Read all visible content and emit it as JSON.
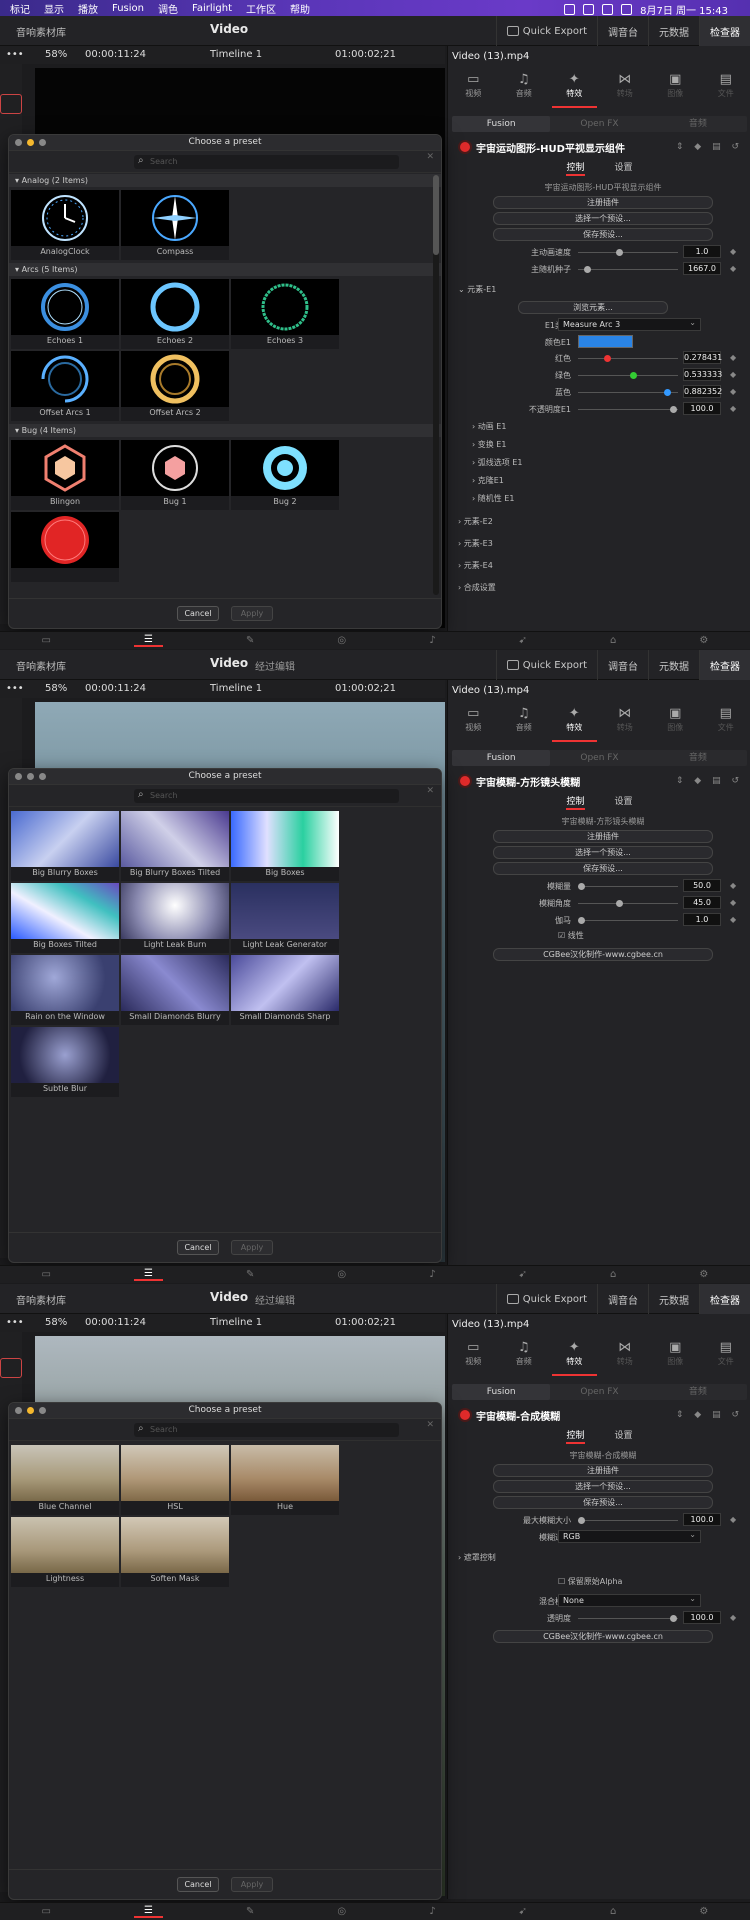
{
  "menubar": {
    "items": [
      "标记",
      "显示",
      "播放",
      "Fusion",
      "调色",
      "Fairlight",
      "工作区",
      "帮助"
    ],
    "datetime": "8月7日 周一 15:43"
  },
  "screens": [
    {
      "lib": "音响素材库",
      "title": "Video",
      "subtitle": "",
      "zoom": "58%",
      "tc_left": "00:00:11:24",
      "timeline": "Timeline 1",
      "tc_right": "01:00:02;21",
      "quick_export": "Quick Export",
      "mix": "调音台",
      "meta": "元数据",
      "inspector": "检查器",
      "filename": "Video (13).mp4",
      "tabs": [
        "视频",
        "音频",
        "特效",
        "转场",
        "图像",
        "文件"
      ],
      "fx_tabs": [
        "Fusion",
        "Open FX",
        "音频"
      ],
      "group_title": "宇宙运动图形-HUD平视显示组件",
      "subtabs": [
        "控制",
        "设置"
      ],
      "dialog": {
        "title": "Choose a preset",
        "search_placeholder": "Search",
        "cancel": "Cancel",
        "apply": "Apply",
        "categories": [
          {
            "name": "Analog (2 Items)",
            "items": [
              "AnalogClock",
              "Compass"
            ]
          },
          {
            "name": "Arcs (5 Items)",
            "items": [
              "Echoes 1",
              "Echoes 2",
              "Echoes 3",
              "Offset Arcs 1",
              "Offset Arcs 2"
            ]
          },
          {
            "name": "Bug (4 Items)",
            "items": [
              "Blingon",
              "Bug 1",
              "Bug 2",
              ""
            ]
          }
        ]
      },
      "panel": {
        "caption": "宇宙运动图形-HUD平视显示组件",
        "btn1": "注册插件",
        "btn2": "选择一个预设...",
        "btn3": "保存预设...",
        "speed_label": "主动画速度",
        "speed": "1.0",
        "seed_label": "主随机种子",
        "seed": "1667.0",
        "element": "元素-E1",
        "browse": "浏览元素...",
        "type_label": "E1类型",
        "type": "Measure Arc 3",
        "color_label": "颜色E1",
        "red_label": "红色",
        "red": "0.278431",
        "green_label": "绿色",
        "green": "0.533333",
        "blue_label": "蓝色",
        "blue": "0.882352",
        "opacity_label": "不透明度E1",
        "opacity": "100.0",
        "subs": [
          "动画 E1",
          "变换 E1",
          "弧线选项 E1",
          "克隆E1",
          "随机性 E1"
        ],
        "more": [
          "元素-E2",
          "元素-E3",
          "元素-E4",
          "合成设置"
        ]
      }
    },
    {
      "lib": "音响素材库",
      "title": "Video",
      "subtitle": "经过编辑",
      "zoom": "58%",
      "tc_left": "00:00:11:24",
      "timeline": "Timeline 1",
      "tc_right": "01:00:02;21",
      "quick_export": "Quick Export",
      "mix": "调音台",
      "meta": "元数据",
      "inspector": "检查器",
      "filename": "Video (13).mp4",
      "tabs": [
        "视频",
        "音频",
        "特效",
        "转场",
        "图像",
        "文件"
      ],
      "fx_tabs": [
        "Fusion",
        "Open FX",
        "音频"
      ],
      "group_title": "宇宙模糊-方形镜头模糊",
      "subtabs": [
        "控制",
        "设置"
      ],
      "dialog": {
        "title": "Choose a preset",
        "search_placeholder": "Search",
        "cancel": "Cancel",
        "apply": "Apply",
        "items": [
          "Big Blurry Boxes",
          "Big Blurry Boxes Tilted",
          "Big Boxes",
          "Big Boxes Tilted",
          "Light Leak Burn",
          "Light Leak Generator",
          "Rain on the Window",
          "Small Diamonds Blurry",
          "Small Diamonds Sharp",
          "Subtle Blur"
        ]
      },
      "panel": {
        "caption": "宇宙模糊-方形镜头模糊",
        "btn1": "注册插件",
        "btn2": "选择一个预设...",
        "btn3": "保存预设...",
        "blur_label": "模糊量",
        "blur": "50.0",
        "angle_label": "模糊角度",
        "angle": "45.0",
        "gamma_label": "伽马",
        "gamma": "1.0",
        "linear": "线性",
        "credit": "CGBee汉化制作-www.cgbee.cn"
      }
    },
    {
      "lib": "音响素材库",
      "title": "Video",
      "subtitle": "经过编辑",
      "zoom": "58%",
      "tc_left": "00:00:11:24",
      "timeline": "Timeline 1",
      "tc_right": "01:00:02;21",
      "quick_export": "Quick Export",
      "mix": "调音台",
      "meta": "元数据",
      "inspector": "检查器",
      "filename": "Video (13).mp4",
      "tabs": [
        "视频",
        "音频",
        "特效",
        "转场",
        "图像",
        "文件"
      ],
      "fx_tabs": [
        "Fusion",
        "Open FX",
        "音频"
      ],
      "group_title": "宇宙模糊-合成模糊",
      "subtabs": [
        "控制",
        "设置"
      ],
      "dialog": {
        "title": "Choose a preset",
        "search_placeholder": "Search",
        "cancel": "Cancel",
        "apply": "Apply",
        "items": [
          "Blue Channel",
          "HSL",
          "Hue",
          "Lightness",
          "Soften Mask"
        ]
      },
      "panel": {
        "caption": "宇宙模糊-合成模糊",
        "btn1": "注册插件",
        "btn2": "选择一个预设...",
        "btn3": "保存预设...",
        "max_label": "最大模糊大小",
        "max": "100.0",
        "ch_label": "模糊通道",
        "ch": "RGB",
        "mask": "遮罩控制",
        "keep_alpha": "保留原始Alpha",
        "blend_label": "混合模式",
        "blend": "None",
        "opacity_label": "透明度",
        "opacity": "100.0",
        "credit": "CGBee汉化制作-www.cgbee.cn"
      }
    }
  ],
  "watermark": "CG"
}
